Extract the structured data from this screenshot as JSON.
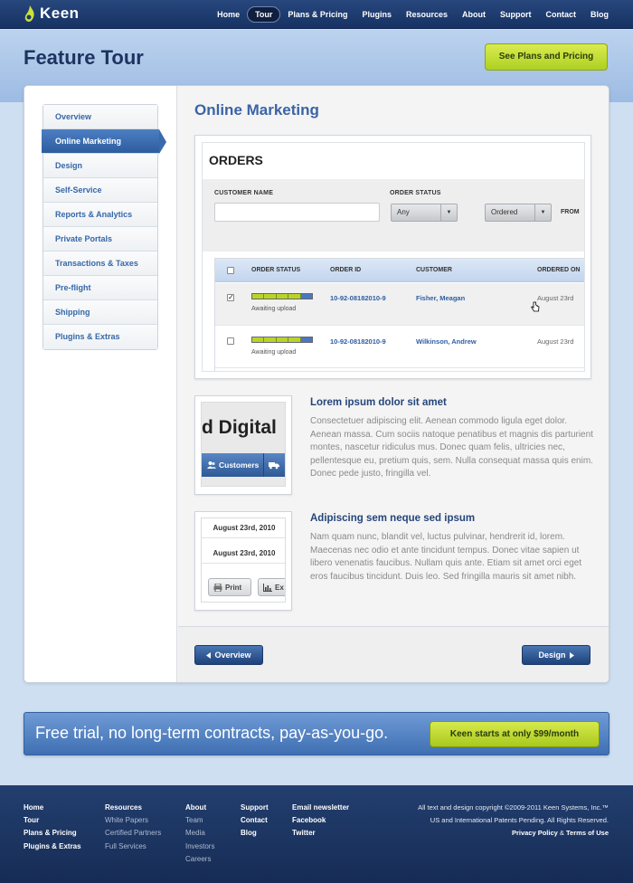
{
  "brand": {
    "name": "Keen"
  },
  "nav": {
    "items": [
      "Home",
      "Tour",
      "Plans & Pricing",
      "Plugins",
      "Resources",
      "About",
      "Support",
      "Contact",
      "Blog"
    ],
    "active_index": 1
  },
  "hero": {
    "title": "Feature Tour",
    "cta": "See Plans and Pricing"
  },
  "sidebar": {
    "items": [
      "Overview",
      "Online Marketing",
      "Design",
      "Self-Service",
      "Reports & Analytics",
      "Private Portals",
      "Transactions & Taxes",
      "Pre-flight",
      "Shipping",
      "Plugins & Extras"
    ],
    "active_index": 1
  },
  "main": {
    "title": "Online Marketing"
  },
  "orders": {
    "title": "ORDERS",
    "filters": {
      "customer_name_label": "CUSTOMER NAME",
      "order_status_label": "ORDER STATUS",
      "status_value": "Any",
      "sort_value": "Ordered",
      "from_label": "FROM"
    },
    "columns": [
      "ORDER STATUS",
      "ORDER ID",
      "CUSTOMER",
      "ORDERED ON"
    ],
    "rows": [
      {
        "checked": true,
        "progress_segments_done": 4,
        "progress_segments_total": 5,
        "status": "Awaiting upload",
        "id": "10-92-08182010-9",
        "customer": "Fisher, Meagan",
        "date": "August 23rd"
      },
      {
        "checked": false,
        "progress_segments_done": 4,
        "progress_segments_total": 5,
        "status": "Awaiting upload",
        "id": "10-92-08182010-9",
        "customer": "Wilkinson, Andrew",
        "date": "August 23rd"
      }
    ]
  },
  "features": [
    {
      "thumb": {
        "headline": "d Digital",
        "button": "Customers"
      },
      "title": "Lorem ipsum dolor sit amet",
      "body": "Consectetuer adipiscing elit. Aenean commodo ligula eget dolor. Aenean massa. Cum sociis natoque penatibus et magnis dis parturient montes, nascetur ridiculus mus. Donec quam felis, ultricies nec, pellentesque eu, pretium quis, sem. Nulla consequat massa quis enim. Donec pede justo, fringilla vel."
    },
    {
      "thumb": {
        "date1": "August 23rd, 2010",
        "date2": "August 23rd, 2010",
        "print": "Print",
        "export": "Ex"
      },
      "title": "Adipiscing sem neque sed ipsum",
      "body": "Nam quam nunc, blandit vel, luctus pulvinar, hendrerit id, lorem. Maecenas nec odio et ante tincidunt tempus. Donec vitae sapien ut libero venenatis faucibus. Nullam quis ante. Etiam sit amet orci eget eros faucibus tincidunt. Duis leo. Sed fringilla mauris sit amet nibh."
    }
  ],
  "pager": {
    "prev": "Overview",
    "next": "Design"
  },
  "promo": {
    "text": "Free trial, no long-term contracts, pay-as-you-go.",
    "cta": "Keen starts at only $99/month"
  },
  "footer": {
    "col1": [
      "Home",
      "Tour",
      "Plans & Pricing",
      "Plugins & Extras"
    ],
    "col2": {
      "head": "Resources",
      "items": [
        "White Papers",
        "Certified Partners",
        "Full Services"
      ]
    },
    "col3": {
      "head": "About",
      "items": [
        "Team",
        "Media",
        "Investors",
        "Careers"
      ]
    },
    "col4": [
      "Support",
      "Contact",
      "Blog"
    ],
    "col5": [
      "Email newsletter",
      "Facebook",
      "Twitter"
    ],
    "copyright1": "All text and design copyright ©2009-2011 Keen Systems, Inc.™",
    "copyright2": "US and International Patents Pending.  All Rights Reserved.",
    "privacy": "Privacy Policy",
    "amp": "&",
    "terms": "Terms of Use"
  },
  "colors": {
    "nav_bg": "#1d3a6c",
    "accent_green": "#c3de38",
    "link_blue": "#3667a8",
    "title_blue": "#3a64a5"
  },
  "icons": [
    "keen-logo-icon",
    "customers-icon",
    "truck-icon",
    "print-icon",
    "chart-icon",
    "cursor-hand-icon",
    "arrow-left-icon",
    "arrow-right-icon",
    "chevron-down-icon"
  ]
}
